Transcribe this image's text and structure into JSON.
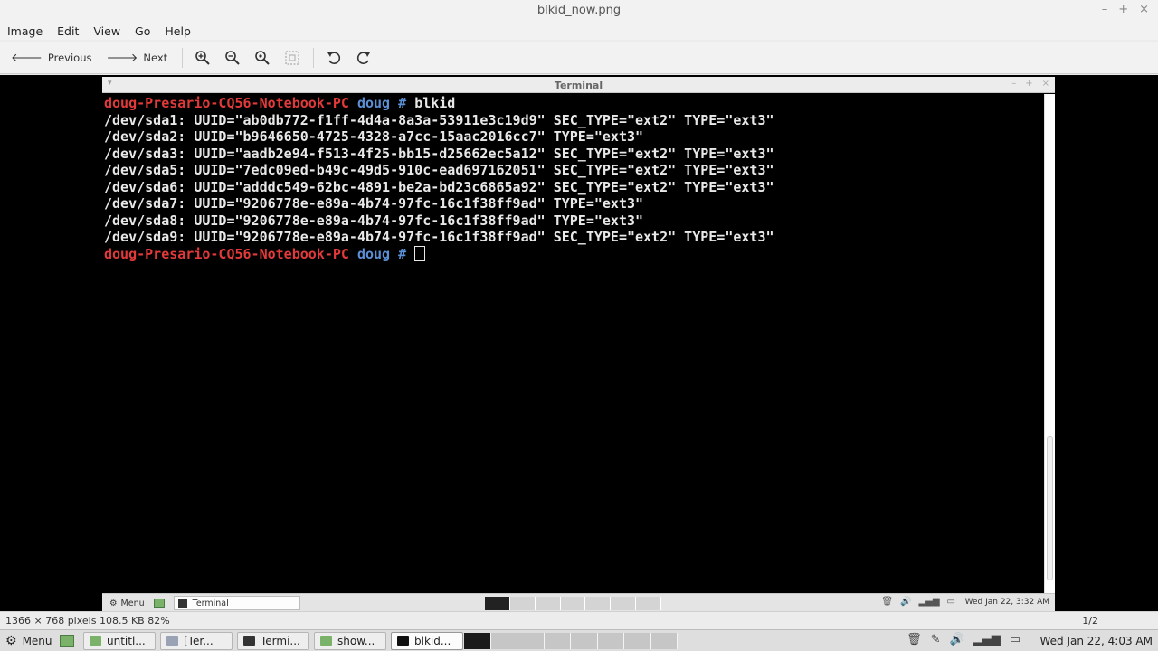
{
  "window": {
    "title": "blkid_now.png",
    "controls": [
      "–",
      "+",
      "×"
    ]
  },
  "menubar": [
    "Image",
    "Edit",
    "View",
    "Go",
    "Help"
  ],
  "toolbar": {
    "previous": "Previous",
    "next": "Next"
  },
  "terminal": {
    "title": "Terminal",
    "prompt_host": "doug-Presario-CQ56-Notebook-PC",
    "prompt_user": "doug",
    "prompt_symbol": "#",
    "command": "blkid",
    "output": [
      "/dev/sda1: UUID=\"ab0db772-f1ff-4d4a-8a3a-53911e3c19d9\" SEC_TYPE=\"ext2\" TYPE=\"ext3\"",
      "/dev/sda2: UUID=\"b9646650-4725-4328-a7cc-15aac2016cc7\" TYPE=\"ext3\"",
      "/dev/sda3: UUID=\"aadb2e94-f513-4f25-bb15-d25662ec5a12\" SEC_TYPE=\"ext2\" TYPE=\"ext3\"",
      "/dev/sda5: UUID=\"7edc09ed-b49c-49d5-910c-ead697162051\" SEC_TYPE=\"ext2\" TYPE=\"ext3\"",
      "/dev/sda6: UUID=\"adddc549-62bc-4891-be2a-bd23c6865a92\" SEC_TYPE=\"ext2\" TYPE=\"ext3\"",
      "/dev/sda7: UUID=\"9206778e-e89a-4b74-97fc-16c1f38ff9ad\" TYPE=\"ext3\"",
      "/dev/sda8: UUID=\"9206778e-e89a-4b74-97fc-16c1f38ff9ad\" TYPE=\"ext3\"",
      "/dev/sda9: UUID=\"9206778e-e89a-4b74-97fc-16c1f38ff9ad\" SEC_TYPE=\"ext2\" TYPE=\"ext3\""
    ],
    "inner_panel": {
      "menu": "Menu",
      "task": "Terminal",
      "clock": "Wed Jan 22,  3:32 AM"
    }
  },
  "statusbar": {
    "info": "1366 × 768 pixels  108.5 KB   82%",
    "page": "1/2"
  },
  "taskbar": {
    "menu": "Menu",
    "tasks": [
      {
        "label": "untitl...",
        "color": "#7ab26a",
        "active": false
      },
      {
        "label": "[Ter...",
        "color": "#9aa3b5",
        "active": false
      },
      {
        "label": "Termi...",
        "color": "#333333",
        "active": false
      },
      {
        "label": "show...",
        "color": "#7ab26a",
        "active": false
      },
      {
        "label": "blkid...",
        "color": "#111111",
        "active": true
      }
    ],
    "clock": "Wed Jan 22,  4:03 AM"
  },
  "colors": {
    "prompt_host": "#e23a3a",
    "prompt_user": "#5b8fd6",
    "terminal_bg": "#000000"
  }
}
